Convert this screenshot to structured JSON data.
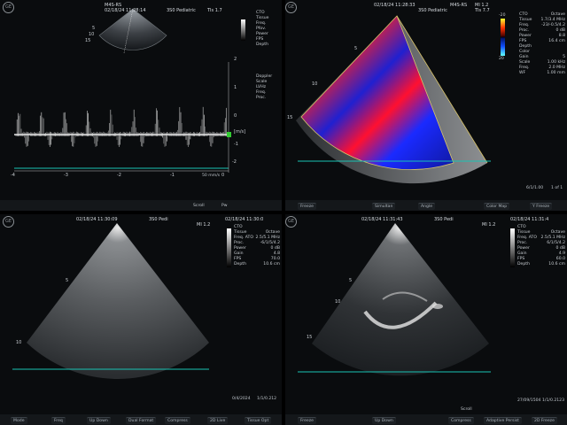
{
  "q1": {
    "logo": "GE",
    "header_probe": "M4S-RS",
    "header_datetime": "02/18/24 11:28:14",
    "header_preset": "3S0 Pediatric",
    "header_ti": "TIs 1.7",
    "params": [
      {
        "label": "CTO",
        "value": ""
      },
      {
        "label": "Tissue",
        "value": ""
      },
      {
        "label": "Freq.",
        "value": ""
      },
      {
        "label": "Pfov.",
        "value": ""
      },
      {
        "label": "Power",
        "value": ""
      },
      {
        "label": "FPS",
        "value": ""
      },
      {
        "label": "Depth",
        "value": ""
      }
    ],
    "doppler_params": [
      {
        "label": "Doppler",
        "value": ""
      },
      {
        "label": "Scale",
        "value": ""
      },
      {
        "label": "LVHz",
        "value": ""
      },
      {
        "label": "Freq.",
        "value": ""
      },
      {
        "label": "Proc.",
        "value": ""
      }
    ],
    "velocity_unit": "[m/s]",
    "velocity_ticks": [
      "2",
      "1",
      "0",
      "-1",
      "-2"
    ],
    "time_ticks": [
      "-4",
      "-3",
      "-2",
      "-1",
      "0"
    ],
    "sweep_label": "50 mm/s",
    "depth_marks": [
      "5",
      "10",
      "15"
    ],
    "footer": [
      "Scroll",
      "Pw"
    ]
  },
  "q2": {
    "logo": "GE",
    "header_datetime": "02/18/24 11:28:33",
    "header_probe": "M4S-RS",
    "header_mi": "MI 1.2",
    "header_preset": "3S0 Pediatric",
    "header_ti": "TIs 7.7",
    "params": [
      {
        "label": "CTO",
        "value": "Octave"
      },
      {
        "label": "Tissue",
        "value": "1.7/3.4 MHz"
      },
      {
        "label": "Freq.",
        "value": "-23/-0.5/4.2"
      },
      {
        "label": "Proc.",
        "value": "0 dB"
      },
      {
        "label": "Power",
        "value": "8.8"
      },
      {
        "label": "FPS",
        "value": "16.4 cm"
      },
      {
        "label": "Depth",
        "value": ""
      },
      {
        "label": "Color",
        "value": ""
      },
      {
        "label": "Gain",
        "value": "5"
      },
      {
        "label": "Scale",
        "value": "1.00 kHz"
      },
      {
        "label": "Freq.",
        "value": "2.0 MHz"
      },
      {
        "label": "WF",
        "value": "1.00 mm"
      }
    ],
    "colorbar_top": "-20",
    "colorbar_bottom": "20",
    "depth_marks": [
      "5",
      "10",
      "15"
    ],
    "footer_buttons": [
      "Freeze",
      "Simultan",
      "Angle",
      "Color Map",
      "Y Freeze"
    ],
    "footer_readout": "6/1/1.00",
    "footer_count": "1 of 1"
  },
  "q3": {
    "logo": "GE",
    "header_datetime": "02/18/24 11:30:09",
    "header_preset": "3S0 Pedi",
    "header_datetime2": "02/18/24 11:30:0",
    "header_mi": "MI 1.2",
    "params": [
      {
        "label": "CTO",
        "value": ""
      },
      {
        "label": "Tissue",
        "value": "Octave"
      },
      {
        "label": "Freq. ATO",
        "value": "2.5/5.1 MHz"
      },
      {
        "label": "Proc.",
        "value": "-6/1/5/4.2"
      },
      {
        "label": "Power",
        "value": "0 dB"
      },
      {
        "label": "Gain",
        "value": "4.8"
      },
      {
        "label": "FPS",
        "value": "70.0"
      },
      {
        "label": "Depth",
        "value": "10.6 cm"
      }
    ],
    "depth_marks": [
      "5",
      "10"
    ],
    "footer_buttons": [
      "Mode",
      "Freq",
      "Up Down",
      "Dual Format",
      "Compress",
      "2D Live",
      "Tissue Opt"
    ],
    "footer_readout": "0/4/2024",
    "footer_readout2": "1/1/0.212"
  },
  "q4": {
    "logo": "GE",
    "header_datetime": "02/18/24 11:31:43",
    "header_preset": "3S0 Pedi",
    "header_datetime2": "02/18/24 11:31:4",
    "header_mi": "MI 1.2",
    "params": [
      {
        "label": "CTO",
        "value": ""
      },
      {
        "label": "Tissue",
        "value": "Octave"
      },
      {
        "label": "Freq. ATO",
        "value": "2.5/5.1 MHz"
      },
      {
        "label": "Proc.",
        "value": "6/1/5/4.2"
      },
      {
        "label": "Power",
        "value": "0 dB"
      },
      {
        "label": "Gain",
        "value": "4.9"
      },
      {
        "label": "FPS",
        "value": "60.0"
      },
      {
        "label": "Depth",
        "value": "10.6 cm"
      }
    ],
    "depth_marks": [
      "5",
      "10",
      "15"
    ],
    "footer_buttons": [
      "Freeze",
      "Up Down",
      "Compress",
      "Adaptive Persist",
      "2D Freeze"
    ],
    "footer_scroll": "Scroll",
    "footer_readout": "27/09/1504",
    "footer_readout2": "1/1/0.2123"
  }
}
